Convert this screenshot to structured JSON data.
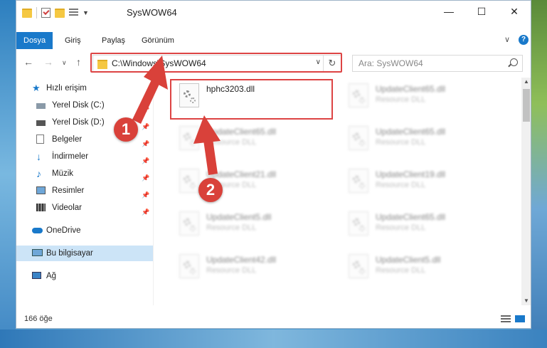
{
  "window": {
    "title": "SysWOW64",
    "controls": {
      "minimize": "—",
      "maximize": "☐",
      "close": "✕"
    }
  },
  "ribbon": {
    "tabs": [
      {
        "label": "Dosya",
        "active": true
      },
      {
        "label": "Giriş",
        "active": false
      },
      {
        "label": "Paylaş",
        "active": false
      },
      {
        "label": "Görünüm",
        "active": false
      }
    ],
    "expand": "∨",
    "help": "?"
  },
  "nav": {
    "back": "←",
    "forward": "→",
    "recent": "∨",
    "up": "↑",
    "address": "C:\\Windows\\SysWOW64",
    "address_dropdown": "∨",
    "refresh": "↻",
    "search_placeholder": "Ara: SysWOW64"
  },
  "sidebar": {
    "items": [
      {
        "label": "Hızlı erişim",
        "icon": "star-icon",
        "pinned": false
      },
      {
        "label": "Yerel Disk (C:)",
        "icon": "drive-icon",
        "pinned": true
      },
      {
        "label": "Yerel Disk (D:)",
        "icon": "drive-icon",
        "pinned": true
      },
      {
        "label": "Belgeler",
        "icon": "documents-icon",
        "pinned": true
      },
      {
        "label": "İndirmeler",
        "icon": "download-icon",
        "pinned": true
      },
      {
        "label": "Müzik",
        "icon": "music-icon",
        "pinned": true
      },
      {
        "label": "Resimler",
        "icon": "pictures-icon",
        "pinned": true
      },
      {
        "label": "Videolar",
        "icon": "videos-icon",
        "pinned": true
      },
      {
        "label": "OneDrive",
        "icon": "cloud-icon",
        "pinned": false
      },
      {
        "label": "Bu bilgisayar",
        "icon": "computer-icon",
        "pinned": false,
        "selected": true
      },
      {
        "label": "Ağ",
        "icon": "network-icon",
        "pinned": false
      }
    ]
  },
  "files": [
    {
      "name": "hphc3203.dll",
      "type": "",
      "highlighted": true
    },
    {
      "name": "UpdateClient65.dll",
      "type": "Resource DLL"
    },
    {
      "name": "UpdateClient65.dll",
      "type": "Resource DLL"
    },
    {
      "name": "UpdateClient65.dll",
      "type": "Resource DLL"
    },
    {
      "name": "UpdateClient21.dll",
      "type": "Resource DLL"
    },
    {
      "name": "UpdateClient19.dll",
      "type": "Resource DLL"
    },
    {
      "name": "UpdateClient5.dll",
      "type": "Resource DLL"
    },
    {
      "name": "UpdateClient65.dll",
      "type": "Resource DLL"
    },
    {
      "name": "UpdateClient42.dll",
      "type": "Resource DLL"
    },
    {
      "name": "UpdateClient5.dll",
      "type": "Resource DLL"
    }
  ],
  "status": {
    "item_count": "166 öğe"
  },
  "callouts": {
    "one": "1",
    "two": "2"
  },
  "colors": {
    "accent": "#1979ca",
    "highlight": "#d44444",
    "callout": "#d9413a"
  }
}
